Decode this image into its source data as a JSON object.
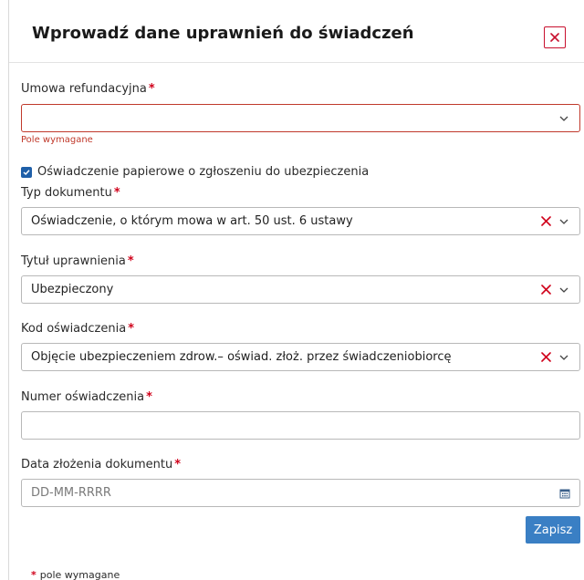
{
  "dialog": {
    "title": "Wprowadź dane uprawnień do świadczeń",
    "close_icon": "close-icon"
  },
  "required_marker": "*",
  "colors": {
    "accent": "#3a7fc4",
    "required": "#d0021b",
    "error": "#c0392b",
    "checkbox": "#1f5fa8"
  },
  "fields": {
    "umowa": {
      "label": "Umowa refundacyjna",
      "value": "",
      "error": "Pole wymagane"
    },
    "oswiadczenie_papierowe": {
      "label": "Oświadczenie papierowe o zgłoszeniu do ubezpieczenia",
      "checked": true
    },
    "typ_dokumentu": {
      "label": "Typ dokumentu",
      "value": "Oświadczenie, o którym mowa w art. 50 ust. 6 ustawy"
    },
    "tytul_uprawnienia": {
      "label": "Tytuł uprawnienia",
      "value": "Ubezpieczony"
    },
    "kod_oswiadczenia": {
      "label": "Kod oświadczenia",
      "value": "Objęcie ubezpieczeniem zdrow.– oświad. złoż. przez świadczeniobiorcę"
    },
    "numer_oswiadczenia": {
      "label": "Numer oświadczenia",
      "value": ""
    },
    "data_zlozenia": {
      "label": "Data złożenia dokumentu",
      "placeholder": "DD-MM-RRRR"
    }
  },
  "actions": {
    "save_label": "Zapisz"
  },
  "footer": {
    "note": "pole wymagane"
  }
}
